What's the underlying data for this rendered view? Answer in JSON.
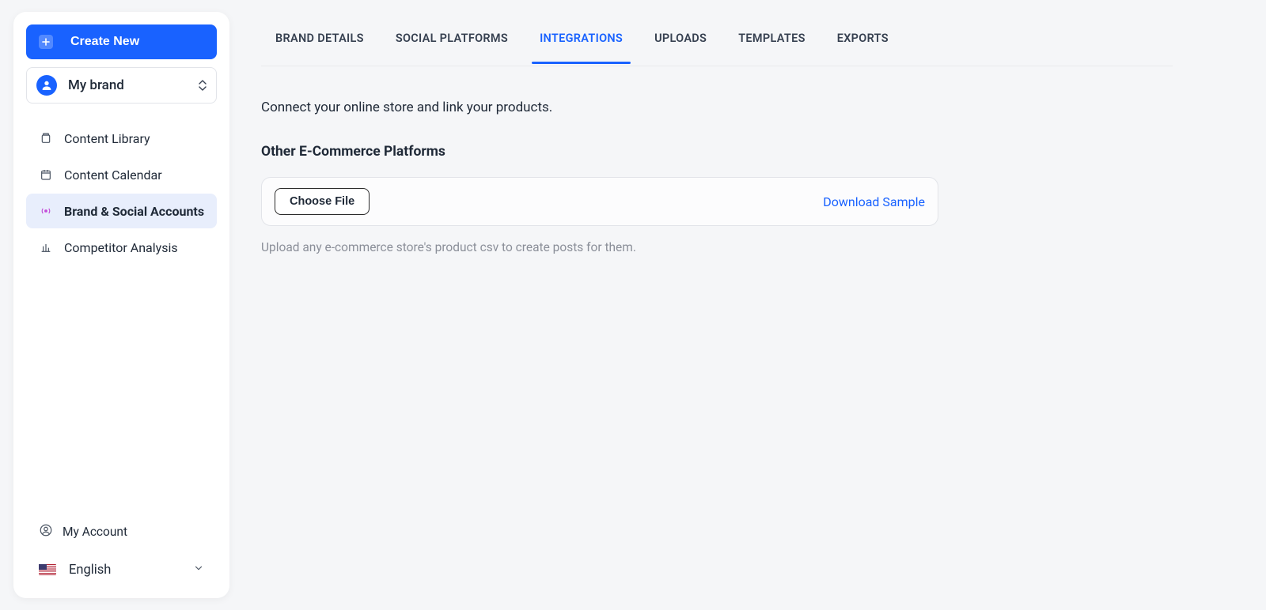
{
  "sidebar": {
    "create_label": "Create New",
    "brand_name": "My brand",
    "nav": [
      {
        "label": "Content Library"
      },
      {
        "label": "Content Calendar"
      },
      {
        "label": "Brand & Social Accounts"
      },
      {
        "label": "Competitor Analysis"
      }
    ],
    "account_label": "My Account",
    "language_label": "English"
  },
  "tabs": [
    {
      "label": "BRAND DETAILS"
    },
    {
      "label": "SOCIAL PLATFORMS"
    },
    {
      "label": "INTEGRATIONS"
    },
    {
      "label": "UPLOADS"
    },
    {
      "label": "TEMPLATES"
    },
    {
      "label": "EXPORTS"
    }
  ],
  "active_tab_index": 2,
  "main": {
    "description": "Connect your online store and link your products.",
    "section_title": "Other E-Commerce Platforms",
    "choose_file_label": "Choose File",
    "download_sample_label": "Download Sample",
    "hint": "Upload any e-commerce store's product csv to create posts for them."
  }
}
